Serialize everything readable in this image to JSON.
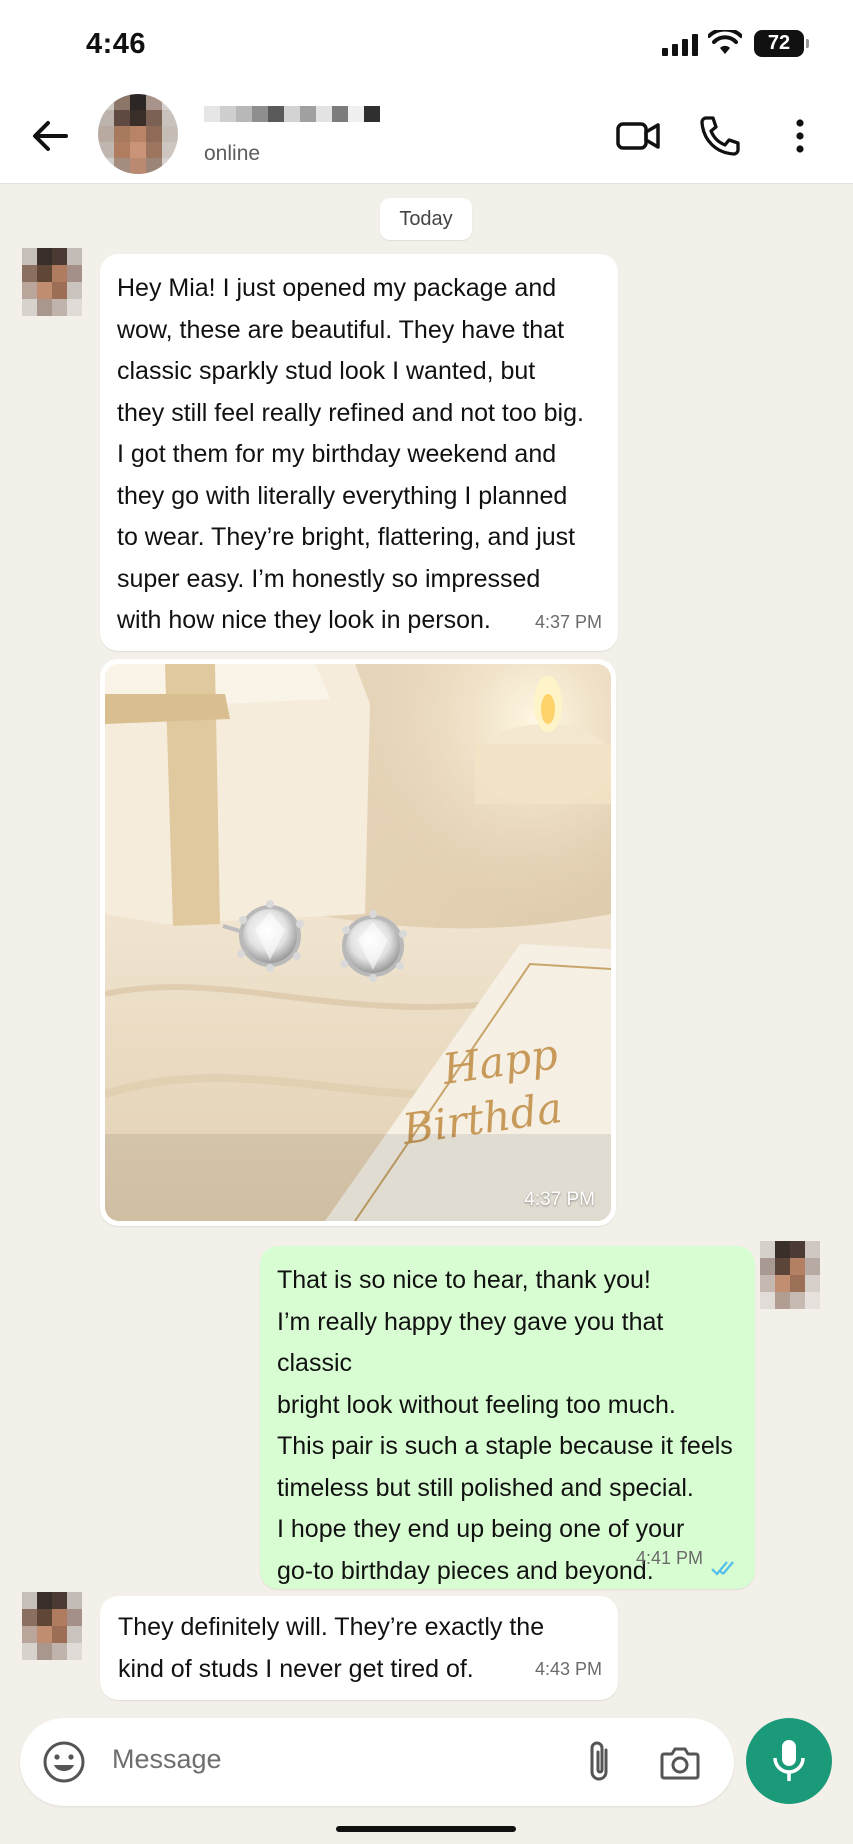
{
  "status_bar": {
    "time": "4:46",
    "battery": "72"
  },
  "header": {
    "status": "online"
  },
  "chat": {
    "date_label": "Today",
    "messages": [
      {
        "direction": "in",
        "text": "Hey Mia! I just opened my package and\nwow, these are beautiful. They have that\nclassic sparkly stud look I wanted, but\nthey still feel really refined and not too big.\nI got them for my birthday weekend and\nthey go with literally everything I planned\nto wear. They’re bright, flattering, and just\nsuper easy. I’m honestly so impressed\nwith how nice they look in person.",
        "time": "4:37 PM"
      },
      {
        "direction": "in",
        "type": "image",
        "image_caption_text": "Happy Birthday",
        "time": "4:37 PM"
      },
      {
        "direction": "out",
        "text": "That is so nice to hear, thank you!\nI’m really happy they gave you that classic\nbright look without feeling too much.\nThis pair is such a staple because it feels\ntimeless but still polished and special.\nI hope they end up being one of your\ngo-to birthday pieces and beyond.",
        "time": "4:41 PM",
        "read": true
      },
      {
        "direction": "in",
        "text": "They definitely will. They’re exactly the\nkind of studs I never get tired of.",
        "time": "4:43 PM"
      }
    ]
  },
  "composer": {
    "placeholder": "Message"
  },
  "colors": {
    "outgoing_bubble": "#d9fdd3",
    "incoming_bubble": "#ffffff",
    "accent": "#1a9a78",
    "read_ticks": "#53bdeb"
  }
}
